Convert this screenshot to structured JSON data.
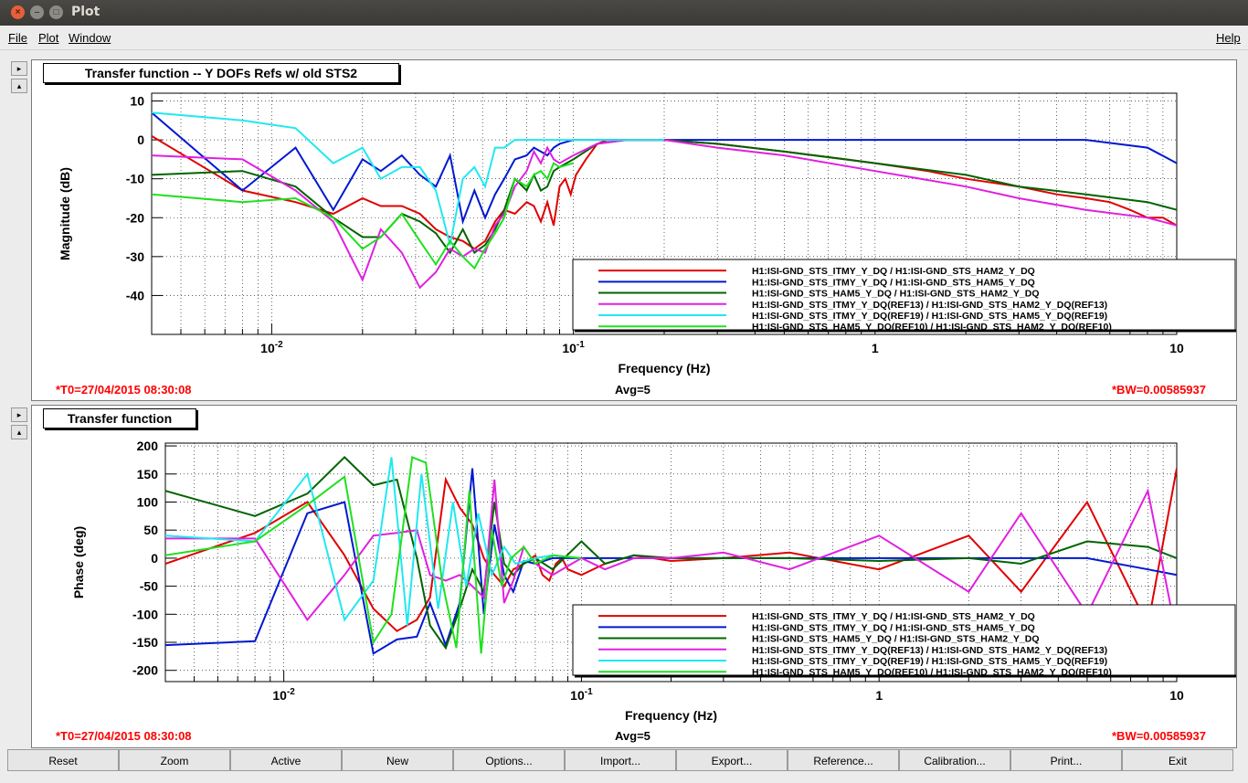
{
  "window": {
    "title": "Plot"
  },
  "menu": {
    "file": "File",
    "plot": "Plot",
    "window": "Window",
    "help": "Help"
  },
  "pad1": {
    "title_box": "Transfer function -- Y DOFs Refs w/ old STS2",
    "t0": "*T0=27/04/2015 08:30:08",
    "avg": "Avg=5",
    "bw": "*BW=0.00585937"
  },
  "pad2": {
    "title_box": "Transfer function",
    "t0": "*T0=27/04/2015 08:30:08",
    "avg": "Avg=5",
    "bw": "*BW=0.00585937"
  },
  "buttons": [
    "Reset",
    "Zoom",
    "Active",
    "New",
    "Options...",
    "Import...",
    "Export...",
    "Reference...",
    "Calibration...",
    "Print...",
    "Exit"
  ],
  "colors": {
    "red": "#e00000",
    "blue": "#0018d0",
    "darkgreen": "#006400",
    "magenta": "#e020e0",
    "cyan": "#20e8f0",
    "green": "#20e020"
  },
  "chart_data": [
    {
      "type": "line",
      "xlabel": "Frequency (Hz)",
      "ylabel": "Magnitude (dB)",
      "xscale": "log",
      "xlim": [
        0.004,
        10
      ],
      "ylim": [
        -50,
        12
      ],
      "xticks": [
        "10-2",
        "10-1",
        "1",
        "10"
      ],
      "yticks": [
        10,
        0,
        -10,
        -20,
        -30,
        -40
      ],
      "grid": true,
      "legend_position": "bottom-right",
      "series": [
        {
          "name": "H1:ISI-GND_STS_ITMY_Y_DQ / H1:ISI-GND_STS_HAM2_Y_DQ",
          "color": "red",
          "x": [
            0.004,
            0.008,
            0.012,
            0.016,
            0.02,
            0.023,
            0.027,
            0.031,
            0.035,
            0.039,
            0.043,
            0.047,
            0.051,
            0.055,
            0.059,
            0.064,
            0.07,
            0.074,
            0.078,
            0.082,
            0.086,
            0.09,
            0.094,
            0.098,
            0.102,
            0.11,
            0.12,
            0.13,
            0.15,
            0.2,
            0.3,
            0.5,
            0.8,
            1,
            1.5,
            2,
            3,
            4,
            5,
            6,
            7,
            8,
            9,
            10
          ],
          "y": [
            1,
            -13,
            -16,
            -19,
            -15,
            -17,
            -17,
            -19,
            -23,
            -25,
            -26,
            -28,
            -26,
            -21,
            -18,
            -19,
            -16,
            -17,
            -21,
            -16,
            -22,
            -12,
            -10,
            -14,
            -9,
            -5,
            -1,
            0,
            0,
            0,
            -1,
            -3,
            -5,
            -6,
            -8,
            -10,
            -12,
            -14,
            -15,
            -16,
            -18,
            -20,
            -20,
            -22
          ]
        },
        {
          "name": "H1:ISI-GND_STS_ITMY_Y_DQ / H1:ISI-GND_STS_HAM5_Y_DQ",
          "color": "blue",
          "x": [
            0.004,
            0.008,
            0.012,
            0.016,
            0.02,
            0.023,
            0.027,
            0.031,
            0.035,
            0.039,
            0.043,
            0.047,
            0.051,
            0.055,
            0.059,
            0.064,
            0.07,
            0.074,
            0.078,
            0.082,
            0.086,
            0.09,
            0.1,
            0.12,
            0.15,
            0.2,
            0.3,
            0.5,
            1,
            2,
            3,
            5,
            8,
            10
          ],
          "y": [
            7,
            -13,
            -2,
            -18,
            -5,
            -8,
            -4,
            -9,
            -12,
            -4,
            -21,
            -13,
            -20,
            -14,
            -10,
            -5,
            -4,
            -2,
            -3,
            -4,
            -2,
            -1,
            0,
            0,
            0,
            0,
            0,
            0,
            0,
            0,
            0,
            0,
            -2,
            -6
          ]
        },
        {
          "name": "H1:ISI-GND_STS_HAM5_Y_DQ / H1:ISI-GND_STS_HAM2_Y_DQ",
          "color": "darkgreen",
          "x": [
            0.004,
            0.008,
            0.012,
            0.016,
            0.02,
            0.023,
            0.027,
            0.031,
            0.035,
            0.039,
            0.043,
            0.047,
            0.051,
            0.055,
            0.059,
            0.064,
            0.07,
            0.074,
            0.078,
            0.082,
            0.086,
            0.09,
            0.1,
            0.12,
            0.15,
            0.2,
            0.3,
            0.5,
            1,
            2,
            3,
            5,
            8,
            10
          ],
          "y": [
            -9,
            -8,
            -12,
            -20,
            -25,
            -25,
            -19,
            -21,
            -24,
            -29,
            -23,
            -29,
            -27,
            -23,
            -18,
            -10,
            -13,
            -9,
            -13,
            -12,
            -8,
            -7,
            -5,
            -1,
            0,
            0,
            -1,
            -3,
            -6,
            -9,
            -12,
            -14,
            -16,
            -18
          ]
        },
        {
          "name": "H1:ISI-GND_STS_ITMY_Y_DQ(REF13) / H1:ISI-GND_STS_HAM2_Y_DQ(REF13)",
          "color": "magenta",
          "x": [
            0.004,
            0.008,
            0.012,
            0.016,
            0.02,
            0.023,
            0.027,
            0.031,
            0.035,
            0.039,
            0.043,
            0.047,
            0.051,
            0.055,
            0.059,
            0.064,
            0.07,
            0.074,
            0.078,
            0.082,
            0.086,
            0.09,
            0.1,
            0.12,
            0.15,
            0.2,
            0.3,
            0.5,
            1,
            2,
            3,
            5,
            8,
            10
          ],
          "y": [
            -4,
            -5,
            -13,
            -21,
            -36,
            -23,
            -29,
            -38,
            -34,
            -28,
            -30,
            -28,
            -29,
            -22,
            -19,
            -12,
            -8,
            -3,
            -6,
            -2,
            -5,
            -6,
            -4,
            -1,
            0,
            0,
            -2,
            -4,
            -8,
            -12,
            -15,
            -18,
            -20,
            -22
          ]
        },
        {
          "name": "H1:ISI-GND_STS_ITMY_Y_DQ(REF19) / H1:ISI-GND_STS_HAM5_Y_DQ(REF19)",
          "color": "cyan",
          "x": [
            0.004,
            0.008,
            0.012,
            0.016,
            0.02,
            0.023,
            0.027,
            0.031,
            0.035,
            0.039,
            0.043,
            0.047,
            0.051,
            0.055,
            0.059,
            0.064,
            0.07,
            0.08,
            0.1,
            0.12,
            0.15,
            0.2
          ],
          "y": [
            7,
            5,
            3,
            -6,
            -2,
            -10,
            -7,
            -7,
            -13,
            -27,
            -10,
            -7,
            -12,
            -2,
            -2,
            0,
            0,
            0,
            0,
            0,
            0,
            0
          ]
        },
        {
          "name": "H1:ISI-GND_STS_HAM5_Y_DQ(REF10) / H1:ISI-GND_STS_HAM2_Y_DQ(REF10)",
          "color": "green",
          "x": [
            0.004,
            0.008,
            0.012,
            0.016,
            0.02,
            0.023,
            0.027,
            0.031,
            0.035,
            0.039,
            0.043,
            0.047,
            0.051,
            0.055,
            0.059,
            0.064,
            0.07,
            0.074,
            0.078,
            0.082,
            0.086,
            0.09,
            0.1
          ],
          "y": [
            -14,
            -16,
            -15,
            -20,
            -28,
            -25,
            -19,
            -26,
            -32,
            -26,
            -30,
            -33,
            -28,
            -24,
            -20,
            -10,
            -12,
            -9,
            -8,
            -10,
            -6,
            -7,
            -6
          ]
        }
      ]
    },
    {
      "type": "line",
      "xlabel": "Frequency (Hz)",
      "ylabel": "Phase (deg)",
      "xscale": "log",
      "xlim": [
        0.004,
        10
      ],
      "ylim": [
        -220,
        205
      ],
      "xticks": [
        "10-2",
        "10-1",
        "1",
        "10"
      ],
      "yticks": [
        200,
        150,
        100,
        50,
        0,
        -50,
        -100,
        -150,
        -200
      ],
      "grid": true,
      "legend_position": "bottom-right",
      "series": [
        {
          "name": "H1:ISI-GND_STS_ITMY_Y_DQ / H1:ISI-GND_STS_HAM2_Y_DQ",
          "color": "red",
          "x": [
            0.004,
            0.008,
            0.012,
            0.016,
            0.02,
            0.024,
            0.028,
            0.031,
            0.035,
            0.039,
            0.043,
            0.047,
            0.051,
            0.055,
            0.059,
            0.064,
            0.07,
            0.074,
            0.078,
            0.082,
            0.086,
            0.09,
            0.1,
            0.12,
            0.15,
            0.2,
            0.3,
            0.5,
            1,
            2,
            3,
            5,
            8,
            10
          ],
          "y": [
            -10,
            45,
            100,
            5,
            -90,
            -130,
            -110,
            -70,
            140,
            90,
            60,
            0,
            -30,
            -50,
            -20,
            -10,
            5,
            -30,
            -40,
            -10,
            0,
            -20,
            -30,
            -10,
            5,
            -5,
            0,
            10,
            -20,
            40,
            -60,
            100,
            -120,
            160
          ]
        },
        {
          "name": "H1:ISI-GND_STS_ITMY_Y_DQ / H1:ISI-GND_STS_HAM5_Y_DQ",
          "color": "blue",
          "x": [
            0.004,
            0.008,
            0.012,
            0.016,
            0.02,
            0.024,
            0.028,
            0.031,
            0.035,
            0.039,
            0.043,
            0.047,
            0.051,
            0.055,
            0.059,
            0.064,
            0.07,
            0.08,
            0.1,
            0.12,
            0.15,
            0.2,
            0.3,
            0.5,
            1,
            2,
            3,
            5,
            8,
            10
          ],
          "y": [
            -155,
            -148,
            80,
            100,
            -170,
            -145,
            -140,
            -80,
            -155,
            -80,
            160,
            -100,
            60,
            -30,
            -60,
            -5,
            -10,
            0,
            0,
            0,
            0,
            0,
            0,
            0,
            0,
            0,
            0,
            0,
            -20,
            -30
          ]
        },
        {
          "name": "H1:ISI-GND_STS_HAM5_Y_DQ / H1:ISI-GND_STS_HAM2_Y_DQ",
          "color": "darkgreen",
          "x": [
            0.004,
            0.008,
            0.012,
            0.016,
            0.02,
            0.024,
            0.028,
            0.031,
            0.035,
            0.039,
            0.043,
            0.047,
            0.051,
            0.055,
            0.059,
            0.064,
            0.07,
            0.08,
            0.1,
            0.12,
            0.15,
            0.2,
            0.3,
            0.5,
            1,
            2,
            3,
            5,
            8,
            10
          ],
          "y": [
            120,
            75,
            115,
            180,
            130,
            140,
            0,
            -120,
            -160,
            -90,
            -20,
            -60,
            100,
            -10,
            -30,
            -10,
            0,
            -20,
            30,
            -10,
            5,
            0,
            0,
            0,
            -5,
            0,
            -10,
            30,
            20,
            0
          ]
        },
        {
          "name": "H1:ISI-GND_STS_ITMY_Y_DQ(REF13) / H1:ISI-GND_STS_HAM2_Y_DQ(REF13)",
          "color": "magenta",
          "x": [
            0.004,
            0.008,
            0.012,
            0.016,
            0.02,
            0.024,
            0.028,
            0.031,
            0.035,
            0.039,
            0.043,
            0.047,
            0.051,
            0.055,
            0.059,
            0.064,
            0.07,
            0.08,
            0.1,
            0.12,
            0.15,
            0.2,
            0.3,
            0.5,
            1,
            2,
            3,
            5,
            8,
            10
          ],
          "y": [
            35,
            35,
            -110,
            -30,
            40,
            45,
            50,
            -30,
            -40,
            -30,
            -50,
            -70,
            140,
            -80,
            -40,
            20,
            -10,
            -30,
            0,
            -20,
            0,
            0,
            10,
            -20,
            40,
            -60,
            80,
            -100,
            120,
            -140
          ]
        },
        {
          "name": "H1:ISI-GND_STS_ITMY_Y_DQ(REF19) / H1:ISI-GND_STS_HAM5_Y_DQ(REF19)",
          "color": "cyan",
          "x": [
            0.004,
            0.008,
            0.012,
            0.016,
            0.02,
            0.023,
            0.026,
            0.029,
            0.033,
            0.037,
            0.041,
            0.045,
            0.05,
            0.055,
            0.06,
            0.07,
            0.08,
            0.1
          ],
          "y": [
            40,
            30,
            150,
            -110,
            -40,
            180,
            -120,
            150,
            -90,
            100,
            -50,
            80,
            -30,
            20,
            -10,
            0,
            5,
            0
          ]
        },
        {
          "name": "H1:ISI-GND_STS_HAM5_Y_DQ(REF10) / H1:ISI-GND_STS_HAM2_Y_DQ(REF10)",
          "color": "green",
          "x": [
            0.004,
            0.008,
            0.012,
            0.016,
            0.02,
            0.023,
            0.027,
            0.03,
            0.034,
            0.038,
            0.042,
            0.046,
            0.05,
            0.054,
            0.058,
            0.064,
            0.07,
            0.08,
            0.1
          ],
          "y": [
            5,
            30,
            95,
            145,
            -150,
            -100,
            180,
            170,
            -40,
            -160,
            120,
            -170,
            50,
            -50,
            0,
            20,
            -10,
            5,
            0
          ]
        }
      ]
    }
  ]
}
